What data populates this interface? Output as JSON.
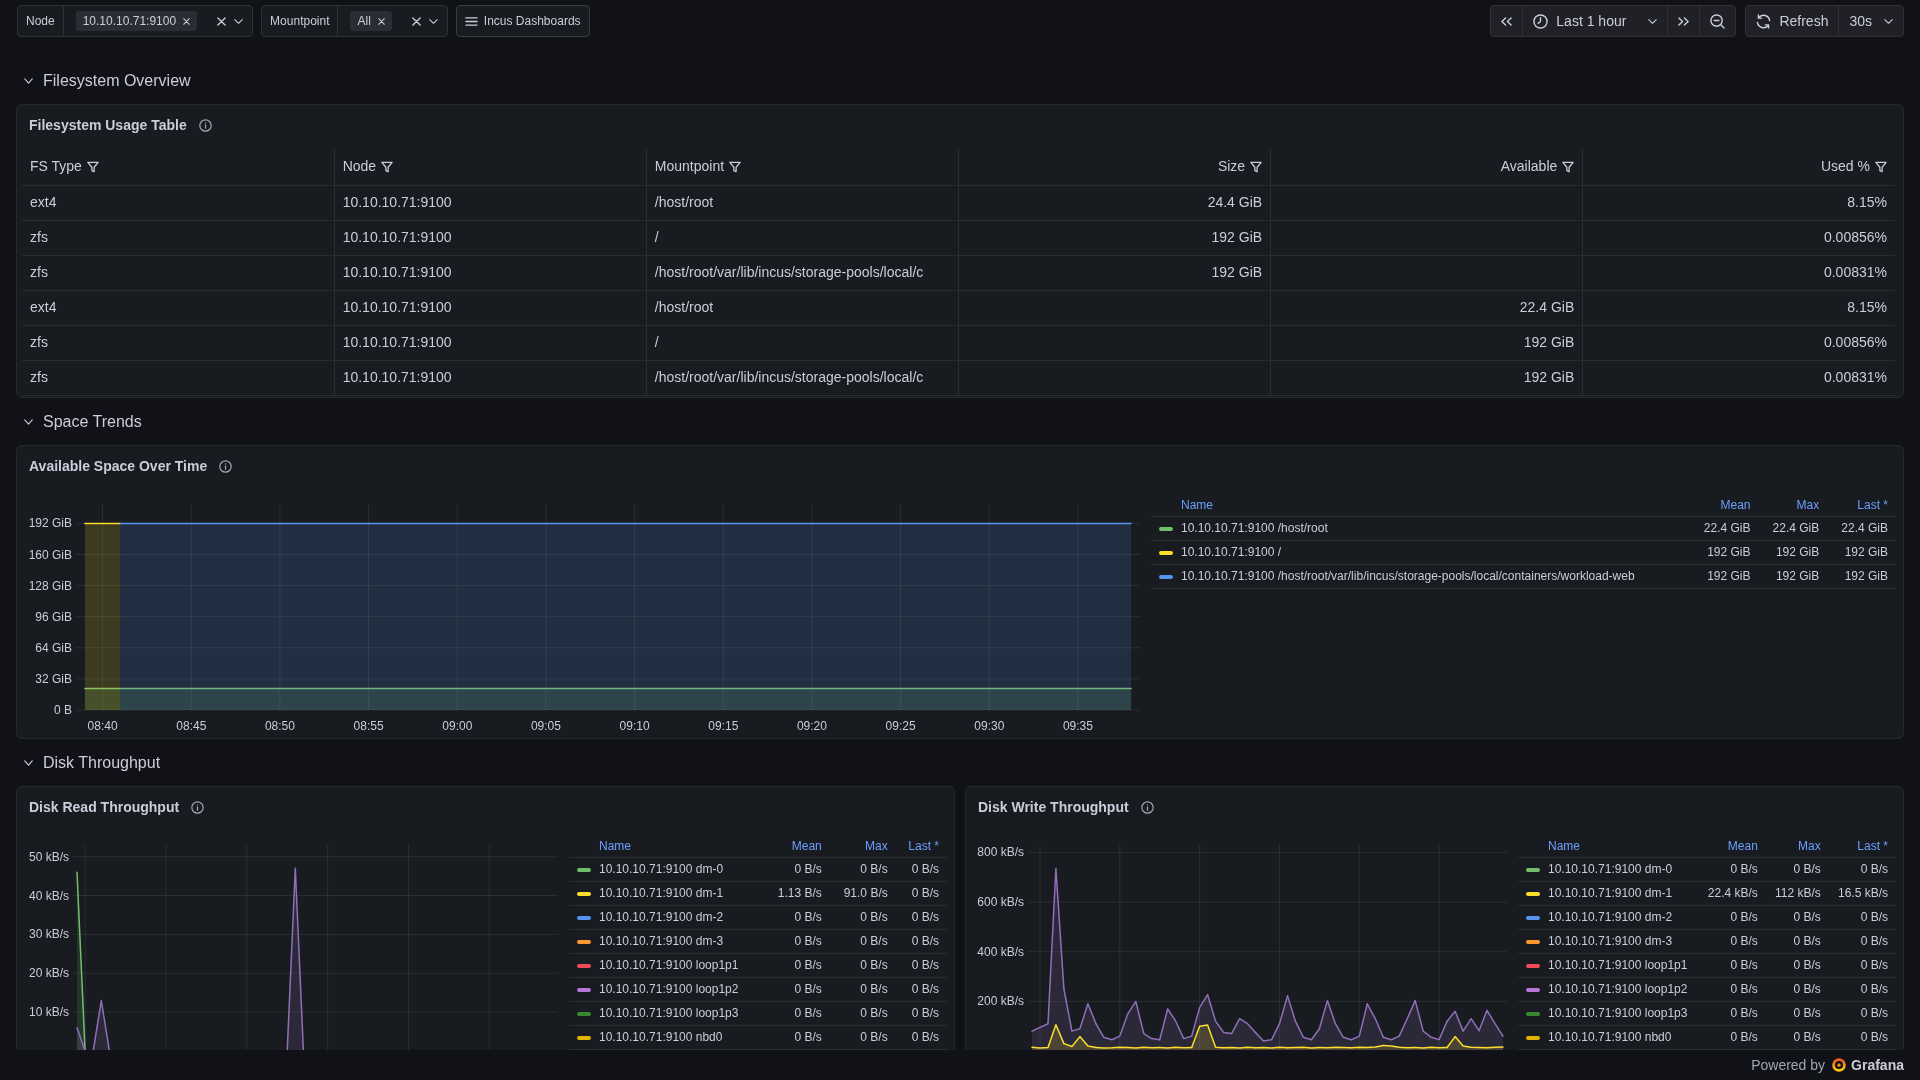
{
  "variables": [
    {
      "label": "Node",
      "values": [
        "10.10.10.71:9100"
      ]
    },
    {
      "label": "Mountpoint",
      "values": [
        "All"
      ]
    }
  ],
  "dashboard_links": [
    {
      "label": "Incus Dashboards"
    }
  ],
  "time_range": {
    "label": "Last 1 hour"
  },
  "refresh": {
    "label": "Refresh",
    "interval": "30s"
  },
  "rows": [
    {
      "title": "Filesystem Overview",
      "expanded": true,
      "panels": [
        {
          "kind": "table",
          "title": "Filesystem Usage Table",
          "columns": [
            {
              "label": "FS Type",
              "kind": "text"
            },
            {
              "label": "Node",
              "kind": "text"
            },
            {
              "label": "Mountpoint",
              "kind": "text"
            },
            {
              "label": "Size",
              "kind": "number"
            },
            {
              "label": "Available",
              "kind": "number"
            },
            {
              "label": "Used %",
              "kind": "number"
            }
          ],
          "rows": [
            [
              "ext4",
              "10.10.10.71:9100",
              "/host/root",
              "24.4 GiB",
              null,
              "8.15%"
            ],
            [
              "zfs",
              "10.10.10.71:9100",
              "/",
              "192 GiB",
              null,
              "0.00856%"
            ],
            [
              "zfs",
              "10.10.10.71:9100",
              "/host/root/var/lib/incus/storage-pools/local/c",
              "192 GiB",
              null,
              "0.00831%"
            ],
            [
              "ext4",
              "10.10.10.71:9100",
              "/host/root",
              null,
              "22.4 GiB",
              "8.15%"
            ],
            [
              "zfs",
              "10.10.10.71:9100",
              "/",
              null,
              "192 GiB",
              "0.00856%"
            ],
            [
              "zfs",
              "10.10.10.71:9100",
              "/host/root/var/lib/incus/storage-pools/local/c",
              null,
              "192 GiB",
              "0.00831%"
            ]
          ]
        }
      ]
    },
    {
      "title": "Space Trends",
      "expanded": true,
      "panels": [
        {
          "kind": "timeseries",
          "title": "Available Space Over Time",
          "chart_data": {
            "type": "area",
            "grid": true,
            "categories": [
              null,
              "08:40",
              null,
              null,
              null,
              null,
              "08:45",
              null,
              null,
              null,
              null,
              "08:50",
              null,
              null,
              null,
              null,
              "08:55",
              null,
              null,
              null,
              null,
              "09:00",
              null,
              null,
              null,
              null,
              "09:05",
              null,
              null,
              null,
              null,
              "09:10",
              null,
              null,
              null,
              null,
              "09:15",
              null,
              null,
              null,
              null,
              "09:20",
              null,
              null,
              null,
              null,
              "09:25",
              null,
              null,
              null,
              null,
              "09:30",
              null,
              null,
              null,
              null,
              "09:35",
              null,
              null,
              null
            ],
            "ylim": [
              0,
              212
            ],
            "yticks": [
              {
                "value": 0,
                "label": "0 B"
              },
              {
                "value": 32,
                "label": "32 GiB"
              },
              {
                "value": 64,
                "label": "64 GiB"
              },
              {
                "value": 96,
                "label": "96 GiB"
              },
              {
                "value": 128,
                "label": "128 GiB"
              },
              {
                "value": 160,
                "label": "160 GiB"
              },
              {
                "value": 192,
                "label": "192 GiB"
              }
            ],
            "series": [
              {
                "color": "#73bf69",
                "values": [
                  22,
                  22,
                  22,
                  22,
                  22,
                  22,
                  22,
                  22,
                  22,
                  22,
                  22,
                  22,
                  22,
                  22,
                  22,
                  22,
                  22,
                  22,
                  22,
                  22,
                  22,
                  22,
                  22,
                  22,
                  22,
                  22,
                  22,
                  22,
                  22,
                  22,
                  22,
                  22,
                  22,
                  22,
                  22,
                  22,
                  22,
                  22,
                  22,
                  22,
                  22,
                  22,
                  22,
                  22,
                  22,
                  22,
                  22,
                  22,
                  22,
                  22,
                  22,
                  22,
                  22,
                  22,
                  22,
                  22,
                  22,
                  22,
                  22,
                  22
                ]
              },
              {
                "color": "#fade2a",
                "values": [
                  192,
                  192,
                  192,
                  null,
                  null,
                  null,
                  null,
                  null,
                  null,
                  null,
                  null,
                  null,
                  null,
                  null,
                  null,
                  null,
                  null,
                  null,
                  null,
                  null,
                  null,
                  null,
                  null,
                  null,
                  null,
                  null,
                  null,
                  null,
                  null,
                  null,
                  null,
                  null,
                  null,
                  null,
                  null,
                  null,
                  null,
                  null,
                  null,
                  null,
                  null,
                  null,
                  null,
                  null,
                  null,
                  null,
                  null,
                  null,
                  null,
                  null,
                  null,
                  null,
                  null,
                  null,
                  null,
                  null,
                  null,
                  null,
                  null,
                  null
                ]
              },
              {
                "color": "#5794f2",
                "values": [
                  null,
                  null,
                  192,
                  192,
                  192,
                  192,
                  192,
                  192,
                  192,
                  192,
                  192,
                  192,
                  192,
                  192,
                  192,
                  192,
                  192,
                  192,
                  192,
                  192,
                  192,
                  192,
                  192,
                  192,
                  192,
                  192,
                  192,
                  192,
                  192,
                  192,
                  192,
                  192,
                  192,
                  192,
                  192,
                  192,
                  192,
                  192,
                  192,
                  192,
                  192,
                  192,
                  192,
                  192,
                  192,
                  192,
                  192,
                  192,
                  192,
                  192,
                  192,
                  192,
                  192,
                  192,
                  192,
                  192,
                  192,
                  192,
                  192,
                  192
                ]
              }
            ]
          },
          "legend": {
            "columns": [
              "Name",
              "Mean",
              "Max",
              "Last *"
            ],
            "rows": [
              {
                "name": "10.10.10.71:9100 /host/root",
                "color": "#73bf69",
                "mean": "22.4 GiB",
                "max": "22.4 GiB",
                "last": "22.4 GiB"
              },
              {
                "name": "10.10.10.71:9100 /",
                "color": "#fade2a",
                "mean": "192 GiB",
                "max": "192 GiB",
                "last": "192 GiB"
              },
              {
                "name": "10.10.10.71:9100 /host/root/var/lib/incus/storage-pools/local/containers/workload-web",
                "color": "#5794f2",
                "mean": "192 GiB",
                "max": "192 GiB",
                "last": "192 GiB"
              }
            ]
          }
        }
      ]
    },
    {
      "title": "Disk Throughput",
      "expanded": true,
      "panels": [
        {
          "kind": "graph",
          "title": "Disk Read Throughput",
          "y_axis_labels": [
            "50 kB/s",
            "40 kB/s",
            "30 kB/s",
            "20 kB/s",
            "10 kB/s"
          ],
          "legend": {
            "columns": [
              "Name",
              "Mean",
              "Max",
              "Last *"
            ],
            "rows": [
              {
                "name": "10.10.10.71:9100 dm-0",
                "color": "#73bf69",
                "mean": "0 B/s",
                "max": "0 B/s",
                "last": "0 B/s"
              },
              {
                "name": "10.10.10.71:9100 dm-1",
                "color": "#fade2a",
                "mean": "1.13 B/s",
                "max": "91.0 B/s",
                "last": "0 B/s"
              },
              {
                "name": "10.10.10.71:9100 dm-2",
                "color": "#5794f2",
                "mean": "0 B/s",
                "max": "0 B/s",
                "last": "0 B/s"
              },
              {
                "name": "10.10.10.71:9100 dm-3",
                "color": "#ff9830",
                "mean": "0 B/s",
                "max": "0 B/s",
                "last": "0 B/s"
              },
              {
                "name": "10.10.10.71:9100 loop1p1",
                "color": "#f2495c",
                "mean": "0 B/s",
                "max": "0 B/s",
                "last": "0 B/s"
              },
              {
                "name": "10.10.10.71:9100 loop1p2",
                "color": "#b877d9",
                "mean": "0 B/s",
                "max": "0 B/s",
                "last": "0 B/s"
              },
              {
                "name": "10.10.10.71:9100 loop1p3",
                "color": "#37872d",
                "mean": "0 B/s",
                "max": "0 B/s",
                "last": "0 B/s"
              },
              {
                "name": "10.10.10.71:9100 nbd0",
                "color": "#e0b400",
                "mean": "0 B/s",
                "max": "0 B/s",
                "last": "0 B/s"
              }
            ]
          }
        },
        {
          "kind": "graph",
          "title": "Disk Write Throughput",
          "y_axis_labels": [
            "800 kB/s",
            "600 kB/s",
            "400 kB/s",
            "200 kB/s"
          ],
          "legend": {
            "columns": [
              "Name",
              "Mean",
              "Max",
              "Last *"
            ],
            "rows": [
              {
                "name": "10.10.10.71:9100 dm-0",
                "color": "#73bf69",
                "mean": "0 B/s",
                "max": "0 B/s",
                "last": "0 B/s"
              },
              {
                "name": "10.10.10.71:9100 dm-1",
                "color": "#fade2a",
                "mean": "22.4 kB/s",
                "max": "112 kB/s",
                "last": "16.5 kB/s"
              },
              {
                "name": "10.10.10.71:9100 dm-2",
                "color": "#5794f2",
                "mean": "0 B/s",
                "max": "0 B/s",
                "last": "0 B/s"
              },
              {
                "name": "10.10.10.71:9100 dm-3",
                "color": "#ff9830",
                "mean": "0 B/s",
                "max": "0 B/s",
                "last": "0 B/s"
              },
              {
                "name": "10.10.10.71:9100 loop1p1",
                "color": "#f2495c",
                "mean": "0 B/s",
                "max": "0 B/s",
                "last": "0 B/s"
              },
              {
                "name": "10.10.10.71:9100 loop1p2",
                "color": "#b877d9",
                "mean": "0 B/s",
                "max": "0 B/s",
                "last": "0 B/s"
              },
              {
                "name": "10.10.10.71:9100 loop1p3",
                "color": "#37872d",
                "mean": "0 B/s",
                "max": "0 B/s",
                "last": "0 B/s"
              },
              {
                "name": "10.10.10.71:9100 nbd0",
                "color": "#e0b400",
                "mean": "0 B/s",
                "max": "0 B/s",
                "last": "0 B/s"
              }
            ]
          }
        }
      ]
    }
  ],
  "footer": {
    "text": "Powered by",
    "brand": "Grafana"
  }
}
